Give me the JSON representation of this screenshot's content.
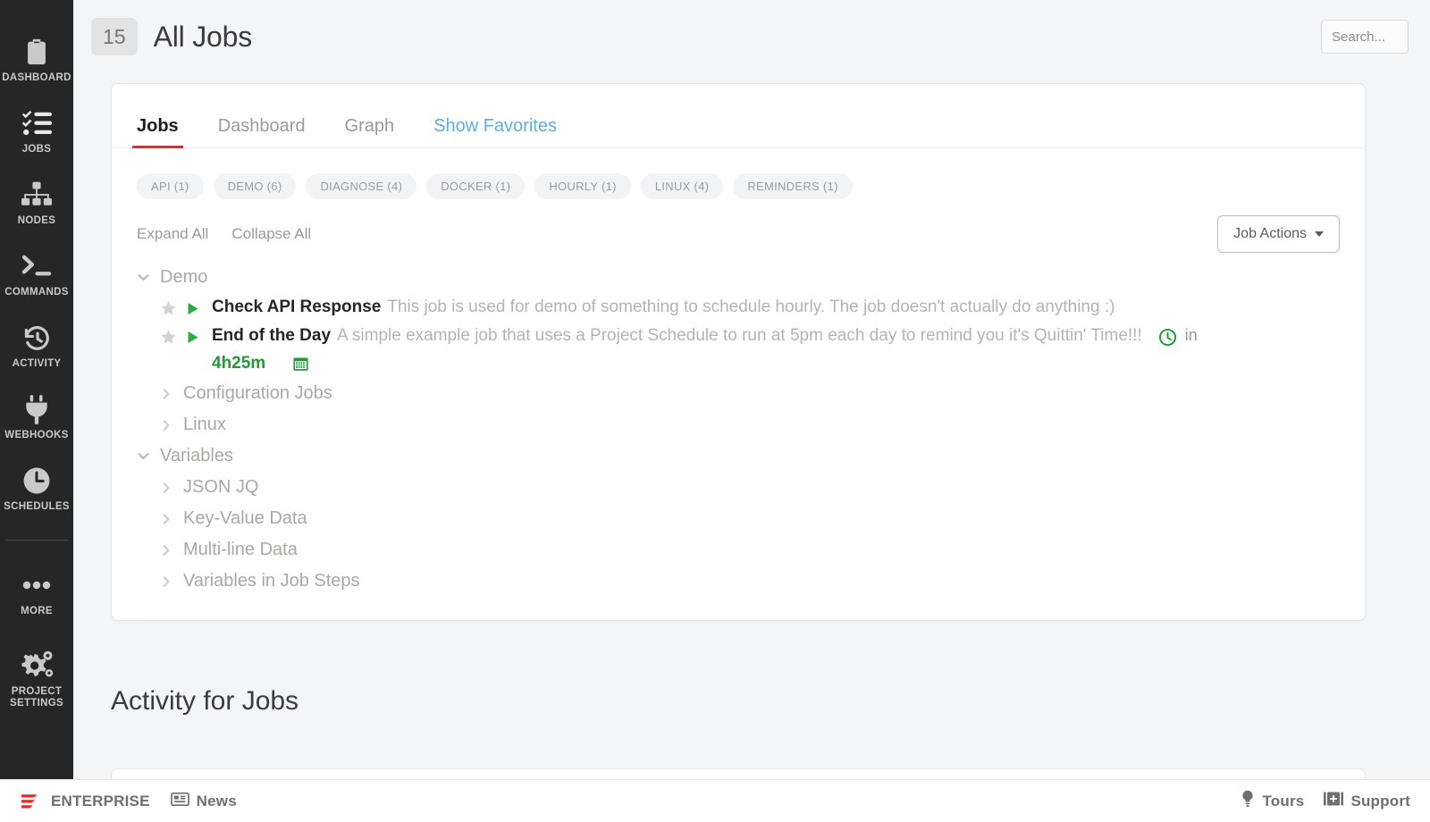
{
  "sidebar": {
    "items": [
      {
        "label": "DASHBOARD",
        "icon": "clipboard-icon"
      },
      {
        "label": "JOBS",
        "icon": "checklist-icon"
      },
      {
        "label": "NODES",
        "icon": "sitemap-icon"
      },
      {
        "label": "COMMANDS",
        "icon": "terminal-icon"
      },
      {
        "label": "ACTIVITY",
        "icon": "history-clock-icon"
      },
      {
        "label": "WEBHOOKS",
        "icon": "plug-icon"
      },
      {
        "label": "SCHEDULES",
        "icon": "clock-icon"
      },
      {
        "label": "MORE",
        "icon": "ellipsis-icon"
      },
      {
        "label": "PROJECT SETTINGS",
        "icon": "gears-icon"
      }
    ]
  },
  "header": {
    "count": "15",
    "title": "All Jobs",
    "search_placeholder": "Search..."
  },
  "tabs": [
    {
      "label": "Jobs",
      "state": "active"
    },
    {
      "label": "Dashboard",
      "state": "inactive"
    },
    {
      "label": "Graph",
      "state": "inactive"
    },
    {
      "label": "Show Favorites",
      "state": "link"
    }
  ],
  "chips": [
    {
      "label": "API (1)"
    },
    {
      "label": "DEMO (6)"
    },
    {
      "label": "DIAGNOSE (4)"
    },
    {
      "label": "DOCKER (1)"
    },
    {
      "label": "HOURLY (1)"
    },
    {
      "label": "LINUX (4)"
    },
    {
      "label": "REMINDERS (1)"
    }
  ],
  "toolbar": {
    "expand_all": "Expand All",
    "collapse_all": "Collapse All",
    "job_actions": "Job Actions"
  },
  "tree": {
    "group_demo": "Demo",
    "jobs": [
      {
        "name": "Check API Response",
        "description": "This job is used for demo of something to schedule hourly. The job doesn't actually do anything :)",
        "scheduled": false
      },
      {
        "name": "End of the Day",
        "description": "A simple example job that uses a Project Schedule to run at 5pm each day to remind you it's Quittin' Time!!!",
        "scheduled": true,
        "schedule_prefix": "in",
        "schedule_time": "4h25m"
      }
    ],
    "collapsed_groups": [
      {
        "label": "Configuration Jobs",
        "indent": 1
      },
      {
        "label": "Linux",
        "indent": 1
      },
      {
        "label": "Variables",
        "indent": 0
      },
      {
        "label": "JSON JQ",
        "indent": 1
      },
      {
        "label": "Key-Value Data",
        "indent": 1
      },
      {
        "label": "Multi-line Data",
        "indent": 1
      },
      {
        "label": "Variables in Job Steps",
        "indent": 1
      }
    ]
  },
  "activity": {
    "title": "Activity for Jobs"
  },
  "footer": {
    "enterprise": "ENTERPRISE",
    "news": "News",
    "tours": "Tours",
    "support": "Support"
  },
  "colors": {
    "accent_red": "#f5241f",
    "link_blue": "#5bade3",
    "success_green": "#1d9c35",
    "sidebar_bg": "#262626",
    "page_bg": "#f4f5f7"
  }
}
